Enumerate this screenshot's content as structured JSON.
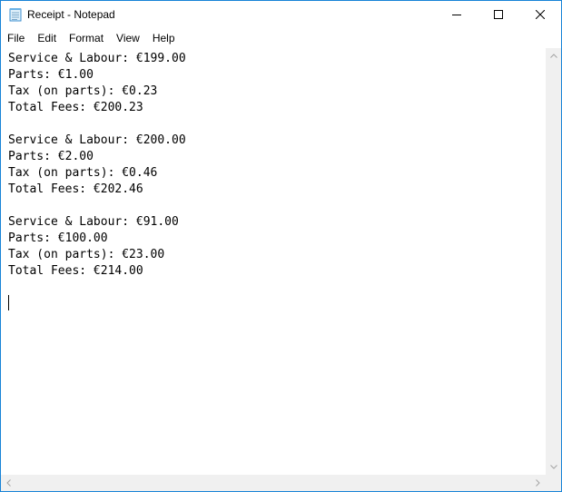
{
  "window": {
    "title": "Receipt - Notepad",
    "icon": "notepad-icon"
  },
  "controls": {
    "minimize_icon": "minimize-icon",
    "maximize_icon": "maximize-icon",
    "close_icon": "close-icon"
  },
  "menu": {
    "items": [
      "File",
      "Edit",
      "Format",
      "View",
      "Help"
    ]
  },
  "document": {
    "lines": [
      "Service & Labour: €199.00",
      "Parts: €1.00",
      "Tax (on parts): €0.23",
      "Total Fees: €200.23",
      "",
      "Service & Labour: €200.00",
      "Parts: €2.00",
      "Tax (on parts): €0.46",
      "Total Fees: €202.46",
      "",
      "Service & Labour: €91.00",
      "Parts: €100.00",
      "Tax (on parts): €23.00",
      "Total Fees: €214.00"
    ]
  },
  "colors": {
    "window_border": "#1883d7",
    "scrollbar_track": "#f0f0f0",
    "scroll_arrow": "#a3a3a3"
  }
}
